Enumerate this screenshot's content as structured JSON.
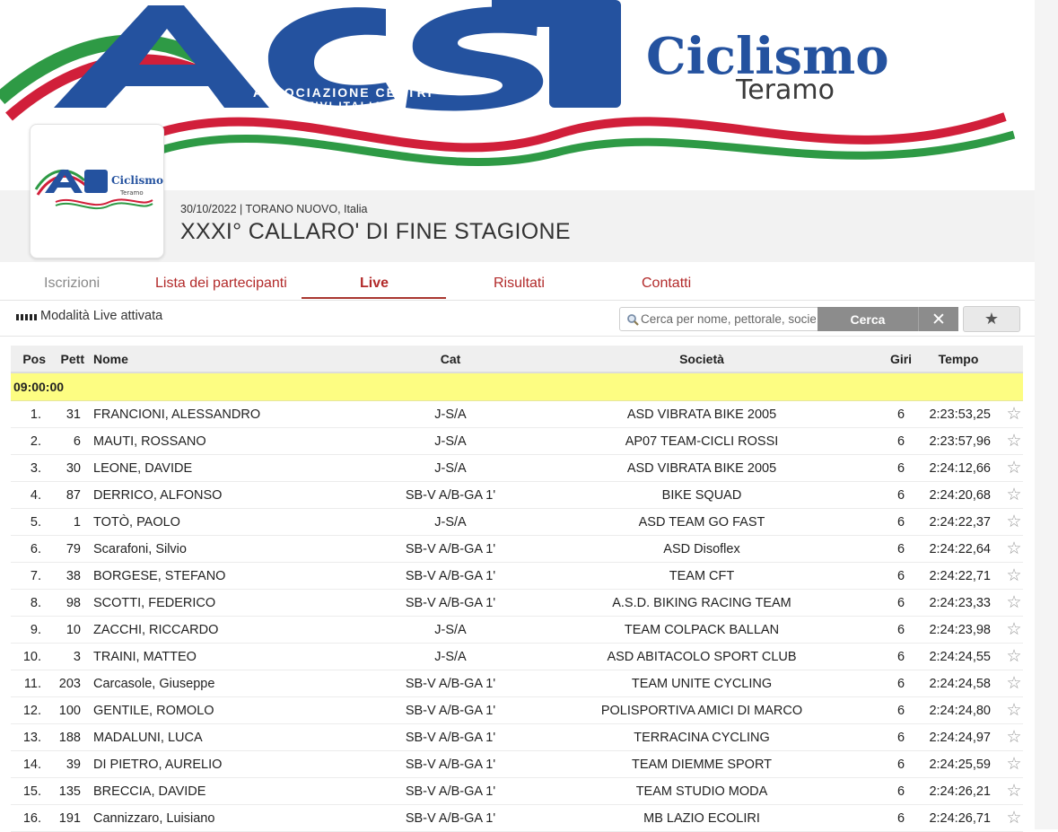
{
  "banner": {
    "logo_letters": "ACSI",
    "association_line1": "ASSOCIAZIONE CENTRI",
    "association_line2": "SPORTIVI ITALIANI",
    "brand_word": "Ciclismo",
    "brand_city": "Teramo",
    "colors": {
      "blue": "#24529f",
      "red": "#d11f3a",
      "green": "#2e9a45"
    }
  },
  "event": {
    "date": "30/10/2022",
    "separator": "|",
    "location": "TORANO NUOVO, Italia",
    "title": "XXXI° CALLARO' DI FINE STAGIONE"
  },
  "tabs": [
    {
      "label": "Iscrizioni",
      "state": "disabled"
    },
    {
      "label": "Lista dei partecipanti",
      "state": "normal"
    },
    {
      "label": "Live",
      "state": "active"
    },
    {
      "label": "Risultati",
      "state": "normal"
    },
    {
      "label": "Contatti",
      "state": "normal"
    }
  ],
  "toolbar": {
    "live_status": "Modalità Live attivata",
    "search_placeholder": "Cerca per nome, pettorale, società...",
    "search_button": "Cerca",
    "clear_icon": "close-icon",
    "favorites_icon": "star-icon"
  },
  "table": {
    "headers": {
      "pos": "Pos",
      "pett": "Pett",
      "nome": "Nome",
      "cat": "Cat",
      "societa": "Società",
      "giri": "Giri",
      "tempo": "Tempo"
    },
    "group_label": "09:00:00",
    "rows": [
      {
        "pos": "1.",
        "pett": "31",
        "nome": "FRANCIONI, ALESSANDRO",
        "cat": "J-S/A",
        "societa": "ASD VIBRATA BIKE 2005",
        "giri": "6",
        "tempo": "2:23:53,25"
      },
      {
        "pos": "2.",
        "pett": "6",
        "nome": "MAUTI, ROSSANO",
        "cat": "J-S/A",
        "societa": "AP07 TEAM-CICLI ROSSI",
        "giri": "6",
        "tempo": "2:23:57,96"
      },
      {
        "pos": "3.",
        "pett": "30",
        "nome": "LEONE, DAVIDE",
        "cat": "J-S/A",
        "societa": "ASD VIBRATA BIKE 2005",
        "giri": "6",
        "tempo": "2:24:12,66"
      },
      {
        "pos": "4.",
        "pett": "87",
        "nome": "DERRICO, ALFONSO",
        "cat": "SB-V A/B-GA 1'",
        "societa": "BIKE SQUAD",
        "giri": "6",
        "tempo": "2:24:20,68"
      },
      {
        "pos": "5.",
        "pett": "1",
        "nome": "TOTÒ, PAOLO",
        "cat": "J-S/A",
        "societa": "ASD TEAM GO FAST",
        "giri": "6",
        "tempo": "2:24:22,37"
      },
      {
        "pos": "6.",
        "pett": "79",
        "nome": "Scarafoni, Silvio",
        "cat": "SB-V A/B-GA 1'",
        "societa": "ASD Disoflex",
        "giri": "6",
        "tempo": "2:24:22,64"
      },
      {
        "pos": "7.",
        "pett": "38",
        "nome": "BORGESE, STEFANO",
        "cat": "SB-V A/B-GA 1'",
        "societa": "TEAM CFT",
        "giri": "6",
        "tempo": "2:24:22,71"
      },
      {
        "pos": "8.",
        "pett": "98",
        "nome": "SCOTTI, FEDERICO",
        "cat": "SB-V A/B-GA 1'",
        "societa": "A.S.D. BIKING RACING TEAM",
        "giri": "6",
        "tempo": "2:24:23,33"
      },
      {
        "pos": "9.",
        "pett": "10",
        "nome": "ZACCHI, RICCARDO",
        "cat": "J-S/A",
        "societa": "TEAM COLPACK BALLAN",
        "giri": "6",
        "tempo": "2:24:23,98"
      },
      {
        "pos": "10.",
        "pett": "3",
        "nome": "TRAINI, MATTEO",
        "cat": "J-S/A",
        "societa": "ASD ABITACOLO SPORT CLUB",
        "giri": "6",
        "tempo": "2:24:24,55"
      },
      {
        "pos": "11.",
        "pett": "203",
        "nome": "Carcasole, Giuseppe",
        "cat": "SB-V A/B-GA 1'",
        "societa": "TEAM UNITE CYCLING",
        "giri": "6",
        "tempo": "2:24:24,58"
      },
      {
        "pos": "12.",
        "pett": "100",
        "nome": "GENTILE, ROMOLO",
        "cat": "SB-V A/B-GA 1'",
        "societa": "POLISPORTIVA AMICI DI MARCO",
        "giri": "6",
        "tempo": "2:24:24,80"
      },
      {
        "pos": "13.",
        "pett": "188",
        "nome": "MADALUNI, LUCA",
        "cat": "SB-V A/B-GA 1'",
        "societa": "TERRACINA CYCLING",
        "giri": "6",
        "tempo": "2:24:24,97"
      },
      {
        "pos": "14.",
        "pett": "39",
        "nome": "DI PIETRO, AURELIO",
        "cat": "SB-V A/B-GA 1'",
        "societa": "TEAM DIEMME SPORT",
        "giri": "6",
        "tempo": "2:24:25,59"
      },
      {
        "pos": "15.",
        "pett": "135",
        "nome": "BRECCIA, DAVIDE",
        "cat": "SB-V A/B-GA 1'",
        "societa": "TEAM STUDIO MODA",
        "giri": "6",
        "tempo": "2:24:26,21"
      },
      {
        "pos": "16.",
        "pett": "191",
        "nome": "Cannizzaro, Luisiano",
        "cat": "SB-V A/B-GA 1'",
        "societa": "MB LAZIO ECOLIRI",
        "giri": "6",
        "tempo": "2:24:26,71"
      }
    ]
  }
}
